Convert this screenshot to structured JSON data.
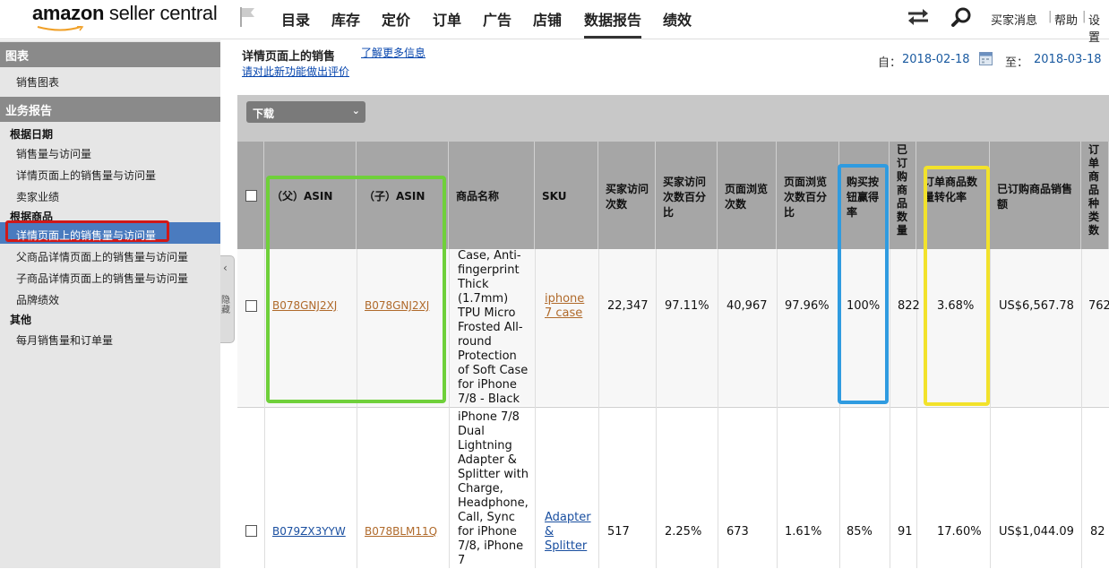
{
  "brand": {
    "logo_bold": "amazon",
    "logo_rest": " seller central"
  },
  "nav": {
    "items": [
      "目录",
      "库存",
      "定价",
      "订单",
      "广告",
      "店铺",
      "数据报告",
      "绩效"
    ],
    "active": "数据报告"
  },
  "top_links": {
    "messages": "买家消息",
    "help": "帮助",
    "settings": "设置"
  },
  "sidebar": {
    "section_charts": "图表",
    "sales_chart": "销售图表",
    "section_business": "业务报告",
    "by_date": "根据日期",
    "by_date_items": [
      "销售量与访问量",
      "详情页面上的销售量与访问量",
      "卖家业绩"
    ],
    "by_product": "根据商品",
    "by_product_items": [
      "详情页面上的销售量与访问量",
      "父商品详情页面上的销售量与访问量",
      "子商品详情页面上的销售量与访问量",
      "品牌绩效"
    ],
    "other": "其他",
    "other_items": [
      "每月销售量和订单量"
    ],
    "collapse_label": "隐藏"
  },
  "page": {
    "title": "详情页面上的销售",
    "learn_more": "了解更多信息",
    "feedback": "请对此新功能做出评价",
    "date_from_label": "自：",
    "date_from": "2018-02-18",
    "date_to_label": "至：",
    "date_to": "2018-03-18",
    "download": "下载"
  },
  "table": {
    "headers": [
      "（父）ASIN",
      "（子）ASIN",
      "商品名称",
      "SKU",
      "买家访问次数",
      "买家访问次数百分比",
      "页面浏览次数",
      "页面浏览次数百分比",
      "购买按钮赢得率",
      "已订购商品数量",
      "订单商品数量转化率",
      "已订购商品销售额",
      "订单商品种类数"
    ],
    "rows": [
      {
        "parent_asin": "B078GNJ2XJ",
        "child_asin": "B078GNJ2XJ",
        "title": "Case, Anti-fingerprint Thick (1.7mm) TPU Micro Frosted All-round Protection of Soft Case for iPhone 7/8 - Black",
        "title_lines": [
          "Case, Anti-",
          "fingerprint",
          "Thick",
          "(1.7mm)",
          "TPU Micro",
          "Frosted All-",
          "round",
          "Protection",
          "of Soft Case",
          "for iPhone",
          "7/8 - Black"
        ],
        "sku_lines": [
          "iphone",
          "7 case"
        ],
        "sessions": "22,347",
        "session_pct": "97.11%",
        "page_views": "40,967",
        "page_view_pct": "97.96%",
        "buy_box_pct": "100%",
        "units_ordered": "822",
        "unit_session_pct": "3.68%",
        "sales": "US$6,567.78",
        "total_items": "762"
      },
      {
        "parent_asin": "B079ZX3YYW",
        "child_asin": "B078BLM11Q",
        "title": "iPhone 7/8 Dual Lightning Adapter & Splitter with Charge, Headphone, Call, Sync for iPhone 7/8, iPhone 7",
        "title_lines": [
          "iPhone 7/8",
          "Dual",
          "Lightning",
          "Adapter &",
          "Splitter with",
          "Charge,",
          "Headphone,",
          "Call, Sync",
          "for iPhone",
          "7/8, iPhone",
          "7"
        ],
        "sku_lines": [
          "Adapter",
          "&",
          "Splitter"
        ],
        "sessions": "517",
        "session_pct": "2.25%",
        "page_views": "673",
        "page_view_pct": "1.61%",
        "buy_box_pct": "85%",
        "units_ordered": "91",
        "unit_session_pct": "17.60%",
        "sales": "US$1,044.09",
        "total_items": "82"
      }
    ]
  },
  "colors": {
    "highlight_green": "#6fd03a",
    "highlight_blue": "#2f9be0",
    "highlight_yellow": "#f2e22b",
    "highlight_red": "#d01818",
    "sidebar_active": "#4a7bbf"
  }
}
